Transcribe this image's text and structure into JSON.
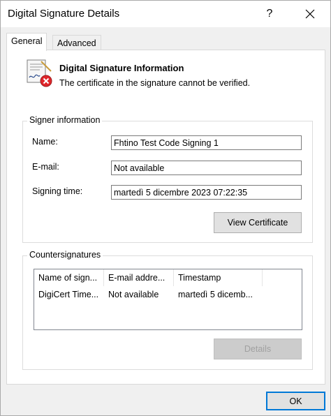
{
  "window": {
    "title": "Digital Signature Details",
    "help_label": "?"
  },
  "tabs": [
    {
      "label": "General",
      "active": true
    },
    {
      "label": "Advanced",
      "active": false
    }
  ],
  "info": {
    "title": "Digital Signature Information",
    "subtitle": "The certificate in the signature cannot be verified.",
    "icon": "certificate-error-icon"
  },
  "signer": {
    "group_label": "Signer information",
    "name_label": "Name:",
    "name_value": "Fhtino Test Code Signing 1",
    "email_label": "E-mail:",
    "email_value": "Not available",
    "time_label": "Signing time:",
    "time_value": "martedì 5 dicembre 2023 07:22:35",
    "view_cert_label": "View Certificate"
  },
  "countersignatures": {
    "group_label": "Countersignatures",
    "columns": [
      "Name of sign...",
      "E-mail addre...",
      "Timestamp"
    ],
    "rows": [
      [
        "DigiCert Time...",
        "Not available",
        "martedì 5 dicemb..."
      ]
    ],
    "details_label": "Details"
  },
  "footer": {
    "ok_label": "OK"
  },
  "colors": {
    "accent": "#0078d7",
    "error": "#e0262b"
  }
}
